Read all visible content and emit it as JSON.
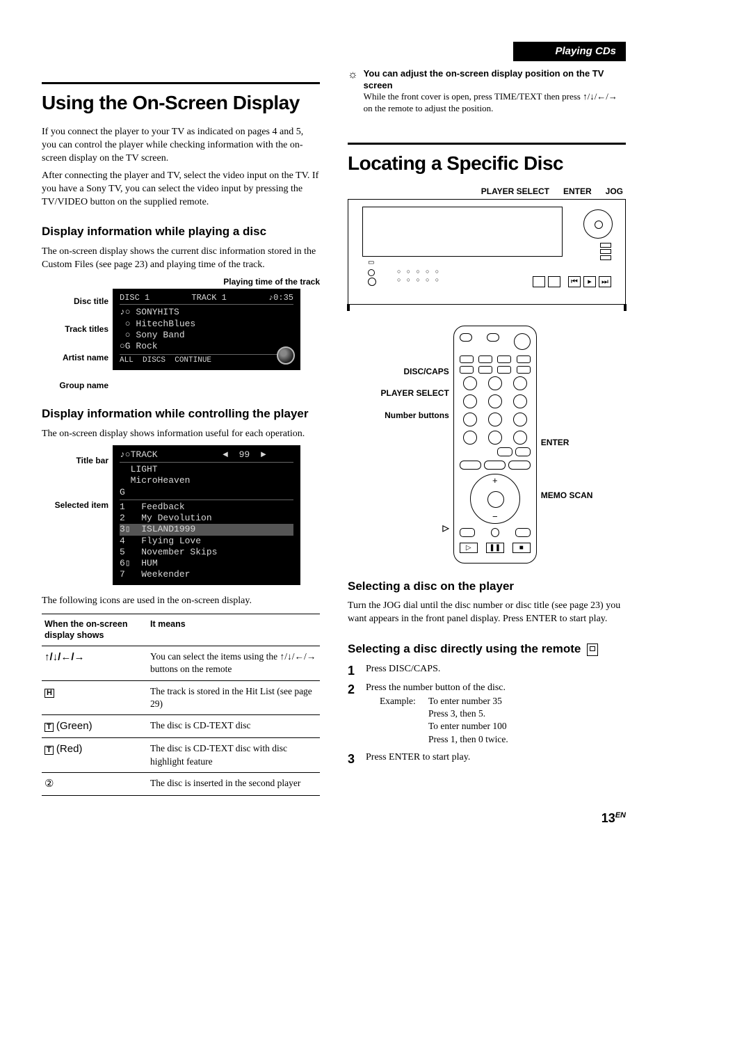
{
  "header": {
    "section": "Playing CDs"
  },
  "left": {
    "h1": "Using the On-Screen Display",
    "p1": "If you connect the player to your TV as indicated on pages 4 and 5, you can control the player while checking information with the on-screen display on the TV screen.",
    "p2": "After connecting the player and TV, select the video input on the TV. If you have a Sony TV, you can select the video input by pressing the TV/VIDEO button on the supplied remote.",
    "sub1": "Display information while playing a disc",
    "sub1p": "The on-screen display shows the current disc information stored in the Custom Files (see page 23) and playing time of the track.",
    "caption_time": "Playing time of the track",
    "osd1_labels": [
      "Disc title",
      "Track titles",
      "Artist name",
      "Group name"
    ],
    "osd1": {
      "top": {
        "disc": "DISC  1",
        "track": "TRACK 1",
        "time": "♪0:35"
      },
      "lines": [
        "♪○ SONYHITS",
        " ○ HitechBlues",
        " ○ Sony Band",
        "○G Rock",
        "ALL  DISCS  CONTINUE"
      ]
    },
    "sub2": "Display information while controlling the player",
    "sub2p": "The on-screen display shows information useful for each operation.",
    "osd2_labels": [
      "Title bar",
      "Selected item"
    ],
    "osd2": {
      "title_row": "♪○TRACK            ◄  99  ►",
      "header_lines": [
        "  LIGHT",
        "  MicroHeaven",
        "G"
      ],
      "list": [
        "1   Feedback",
        "2   My Devolution",
        "3▯  ISLAND1999",
        "4   Flying Love",
        "5   November Skips",
        "6▯  HUM",
        "7   Weekender"
      ]
    },
    "following": "The following icons are used in the on-screen display.",
    "table": {
      "h1": "When the on-screen display shows",
      "h2": "It means",
      "rows": [
        {
          "sym": "↑/↓/←/→",
          "mean": "You can select the items using the ↑/↓/←/→ buttons on the remote"
        },
        {
          "sym": "H",
          "boxed": true,
          "mean": "The track is stored in the Hit List (see page 29)"
        },
        {
          "sym": "T",
          "boxed": true,
          "suffix": " (Green)",
          "mean": "The disc is CD-TEXT disc"
        },
        {
          "sym": "T",
          "boxed": true,
          "suffix": " (Red)",
          "mean": "The disc is CD-TEXT disc with disc highlight feature"
        },
        {
          "sym": "②",
          "mean": "The disc is inserted in the second player"
        }
      ]
    }
  },
  "right": {
    "tip_head": "You can adjust the on-screen display position on the TV screen",
    "tip_body": "While the front cover is open, press TIME/TEXT then press ↑/↓/←/→ on the remote to adjust the position.",
    "h1": "Locating a Specific Disc",
    "top_labels": [
      "PLAYER SELECT",
      "ENTER",
      "JOG"
    ],
    "remote_left_labels": [
      "DISC/CAPS",
      "PLAYER SELECT",
      "Number buttons"
    ],
    "remote_right_labels": [
      "ENTER",
      "MEMO SCAN"
    ],
    "play_glyph": "▷",
    "sub1": "Selecting a disc on the player",
    "sub1p": "Turn the JOG dial until the disc number or disc title (see page 23) you want appears in the front panel display. Press ENTER to start play.",
    "sub2": "Selecting a disc directly using the remote",
    "steps": [
      {
        "t": "Press DISC/CAPS."
      },
      {
        "t": "Press the number button of the disc.",
        "example": [
          [
            "Example:",
            "To enter number 35"
          ],
          [
            "",
            "Press 3, then 5."
          ],
          [
            "",
            "To enter number 100"
          ],
          [
            "",
            "Press 1, then 0 twice."
          ]
        ]
      },
      {
        "t": "Press ENTER to start play."
      }
    ]
  },
  "page": {
    "num": "13",
    "lang": "EN"
  }
}
